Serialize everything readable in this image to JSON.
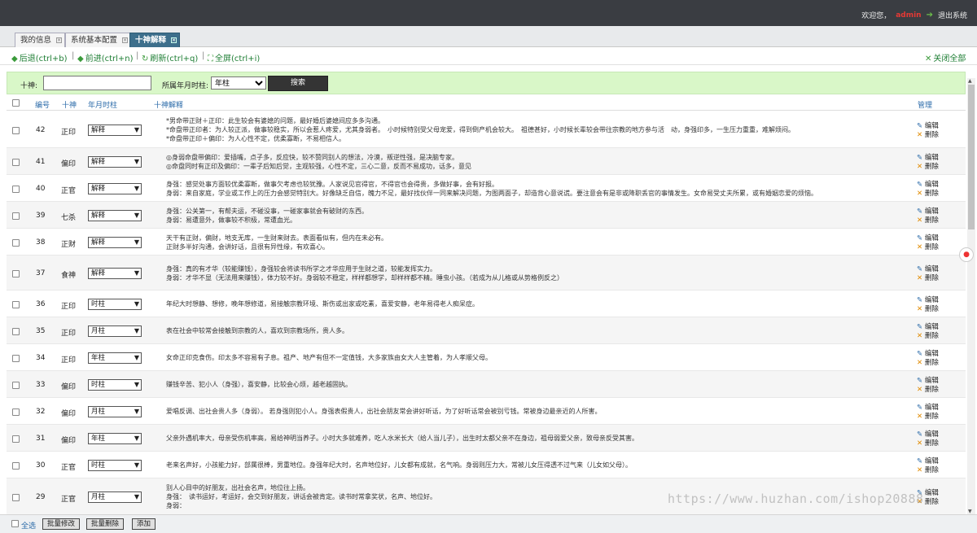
{
  "topbar": {
    "welcome": "欢迎您，",
    "user": "admin",
    "logout": "退出系统",
    "logout_icon": "exit-arrow-icon"
  },
  "tabs": [
    {
      "label": "我的信息"
    },
    {
      "label": "系统基本配置"
    },
    {
      "label": "十神解释"
    }
  ],
  "toolbar": {
    "back": "后退(ctrl+b)",
    "forward": "前进(ctrl+n)",
    "refresh": "刷新(ctrl+q)",
    "fullscreen": "全屏(ctrl+i)",
    "close_all": "关闭全部",
    "sep": "|"
  },
  "search": {
    "shishen_label": "十神:",
    "shishen_value": "",
    "pillar_label": "所属年月时柱:",
    "pillar_selected": "年柱",
    "submit": "搜索"
  },
  "table": {
    "headers": {
      "id": "编号",
      "shishen": "十神",
      "pillar": "年月时柱",
      "desc": "十神解释",
      "ops": "管理"
    },
    "edit_label": "编辑",
    "delete_label": "删除",
    "rows": [
      {
        "id": "42",
        "shishen": "正印",
        "pillar": "解释",
        "lines": [
          "*男命带正财＋正印：此生较会有婆媳的问题，最好婚后婆媳间应多多沟通。",
          "*命盘带正印者：为人较正派，做事较稳实，所以会惹人疼爱，尤其身弱者。　小时候特别受父母宠爱，得到倒产机会较大。　祖德甚好，小时候长辈较会带往宗教的地方参与活　动，身强印多，一生压力重重，难解烦闷。",
          "*命盘带正印＋偏印：为人心性不定，优柔寡断，不易相信人。"
        ]
      },
      {
        "id": "41",
        "shishen": "偏印",
        "pillar": "解释",
        "lines": [
          "◎身弱命盘带偏印：爱插嘴，点子多，反应快，较不赞同别人的想法，冷漠，叛逆性强，是决脑专家。",
          "◎命盘同时有正印及偏印：一辈子后知后觉，主观较强，心性不定，三心二意，反而不易成功，话多，意见"
        ]
      },
      {
        "id": "40",
        "shishen": "正官",
        "pillar": "解释",
        "lines": [
          "身强：感觉处事方面较优柔寡断，做事欠考虑也较犹豫。人家说见官得官，不得官也会得贵，多做好事，会有好报。",
          "身弱：来自家庭，学业或工作上的压力会感觉特别大。好像缺乏自信，魄力不足，最好找伙伴一同来解决问题，为图两面子，却造背心意说谎。要注意会有是非或降职丢官的事情发生。女命易受丈夫所累，或有婚姻恋爱的烦恼。"
        ]
      },
      {
        "id": "39",
        "shishen": "七杀",
        "pillar": "解释",
        "lines": [
          "身强：公关第一，有帮夫运，不碰没事，一碰家事就会有破财的东西。",
          "身弱：易遭意外，做事较不积极，常遭血光。"
        ]
      },
      {
        "id": "38",
        "shishen": "正财",
        "pillar": "解释",
        "lines": [
          "天干有正财，偏财，地支无库，一生财来财去。表面看似有，但内在未必有。",
          "正财多半好沟通，会讲好话，且很有异性缘，有欢喜心。"
        ]
      },
      {
        "id": "37",
        "shishen": "食神",
        "pillar": "解释",
        "lines": [
          "身强：真的有才华（较能赚钱），身强较会将读书所学之才华应用于生财之道，较能发挥实力。",
          "身弱：才华不显（无法用来赚钱），体力较不好。身弱较不稳定，样样都想学，却样样都不精。睡虫小孩。（若成为从儿格或从势格例反之）"
        ]
      },
      {
        "id": "36",
        "shishen": "正印",
        "pillar": "时柱",
        "lines": [
          "年纪大时想静、想修，晚年想修道，易接触宗教环境、斯伤或出家或吃素，喜爱安静，老年易得老人痴呆症。"
        ]
      },
      {
        "id": "35",
        "shishen": "正印",
        "pillar": "月柱",
        "lines": [
          "表在社会中较常会接触到宗教的人，喜欢到宗教场所，贵人多。"
        ]
      },
      {
        "id": "34",
        "shishen": "正印",
        "pillar": "年柱",
        "lines": [
          "女命正印克食伤。印太多不容易有子息。祖产、地产有但不一定值钱，大多家族由女大人主管着，为人孝顺父母。"
        ]
      },
      {
        "id": "33",
        "shishen": "偏印",
        "pillar": "时柱",
        "lines": [
          "赚钱辛苦、犯小人（身强），喜安静，比较会心烦，越老越固执。"
        ]
      },
      {
        "id": "32",
        "shishen": "偏印",
        "pillar": "月柱",
        "lines": [
          "爱唱反调、出社会贵人多（身弱）。 若身强则犯小人。身强表假贵人，出社会朋友常会讲好听话，为了好听话常会被别亏钱。常被身边最亲近的人所害。"
        ]
      },
      {
        "id": "31",
        "shishen": "偏印",
        "pillar": "年柱",
        "lines": [
          "父亲外遇机率大，母亲受伤机率高，易给神明当养子。小时大多就难养，吃人水米长大（给人当儿子），出生时太都父亲不在身边，祖母弱爱父亲，致母亲反受其害。"
        ]
      },
      {
        "id": "30",
        "shishen": "正官",
        "pillar": "时柱",
        "lines": [
          "老来名声好，小孩能力好，部属很棒，男重地位。身强年纪大时，名声地位好，儿女都有成就，名气响。身弱则压力大，常被儿女压得透不过气来（儿女如父母）。"
        ]
      },
      {
        "id": "29",
        "shishen": "正官",
        "pillar": "月柱",
        "lines": [
          "别人心目中的好朋友，出社会名声，地位往上扬。",
          "身强：　读书运好，考运好，会交到好朋友，讲话会被肯定。读书时常拿奖状，名声、地位好。",
          "身弱："
        ]
      }
    ]
  },
  "footer": {
    "select_all": "全选",
    "batch_edit": "批量修改",
    "batch_delete": "批量删除",
    "add": "添加"
  },
  "watermark": "https://www.huzhan.com/ishop20888"
}
